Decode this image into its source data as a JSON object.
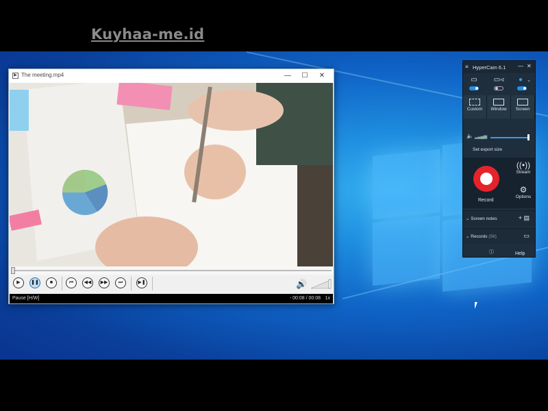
{
  "watermark": "Kuyhaa-me.id",
  "player": {
    "title": "The meeting.mp4",
    "status": "Pause [H/W]",
    "time": "- 00:08 / 00:08",
    "speed": "1x",
    "window_buttons": [
      "—",
      "☐",
      "✕"
    ],
    "controls": [
      "play",
      "pause",
      "stop",
      "prev",
      "rewind",
      "forward",
      "next",
      "frame-step"
    ]
  },
  "hypercam": {
    "title": "HyperCam 6.1",
    "menu": "≡",
    "minimize": "—",
    "close": "✕",
    "sources": [
      {
        "icon": "monitor-icon",
        "glyph": "▭",
        "on": true
      },
      {
        "icon": "webcam-icon",
        "glyph": "▭◃",
        "on": false
      },
      {
        "icon": "microphone-icon",
        "glyph": "🎙",
        "on": true
      }
    ],
    "modes": [
      "Custom",
      "Window",
      "Screen"
    ],
    "export_label": "Set export size",
    "record_label": "Record",
    "stream_label": "Stream",
    "options_label": "Options",
    "screen_notes_label": "Screen notes",
    "records_label": "Records",
    "records_count": "(56)",
    "help_label": "Help",
    "colors": {
      "panel": "#1f2e3d",
      "accent": "#2b8fe0",
      "record": "#e5232b"
    }
  }
}
